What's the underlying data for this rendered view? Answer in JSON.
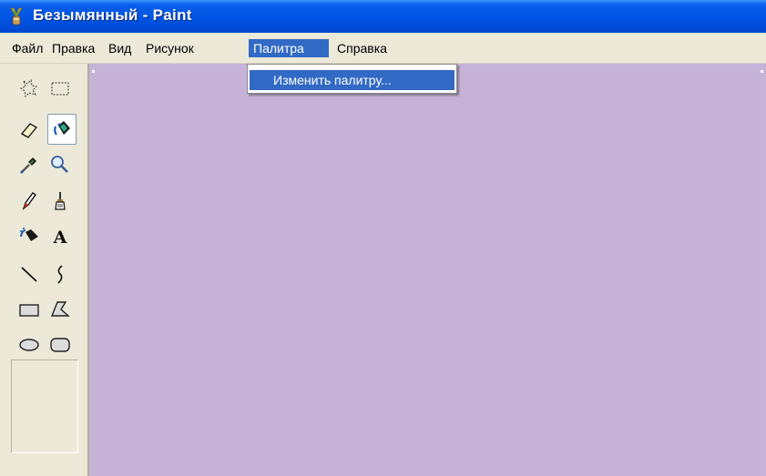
{
  "window": {
    "title": "Безымянный - Paint"
  },
  "menubar": {
    "items": [
      {
        "label": "Файл"
      },
      {
        "label": "Правка"
      },
      {
        "label": "Вид"
      },
      {
        "label": "Рисунок"
      },
      {
        "label": "Палитра",
        "active": true
      },
      {
        "label": "Справка"
      }
    ]
  },
  "dropdown": {
    "items": [
      {
        "label": "Изменить палитру..."
      }
    ]
  },
  "toolbox": {
    "tools": [
      {
        "name": "free-form-select-icon"
      },
      {
        "name": "rect-select-icon"
      },
      {
        "name": "eraser-icon"
      },
      {
        "name": "fill-icon",
        "selected": true
      },
      {
        "name": "color-picker-icon"
      },
      {
        "name": "magnifier-icon"
      },
      {
        "name": "pencil-icon"
      },
      {
        "name": "brush-icon"
      },
      {
        "name": "airbrush-icon"
      },
      {
        "name": "text-icon",
        "glyph": "A"
      },
      {
        "name": "line-icon"
      },
      {
        "name": "curve-icon"
      },
      {
        "name": "rectangle-icon"
      },
      {
        "name": "polygon-icon"
      },
      {
        "name": "ellipse-icon"
      },
      {
        "name": "rounded-rectangle-icon"
      }
    ]
  },
  "colors": {
    "titlebar": "#0054e3",
    "menu_highlight": "#316ac5",
    "canvas": "#c6b2d7",
    "chrome": "#ece9d8"
  }
}
